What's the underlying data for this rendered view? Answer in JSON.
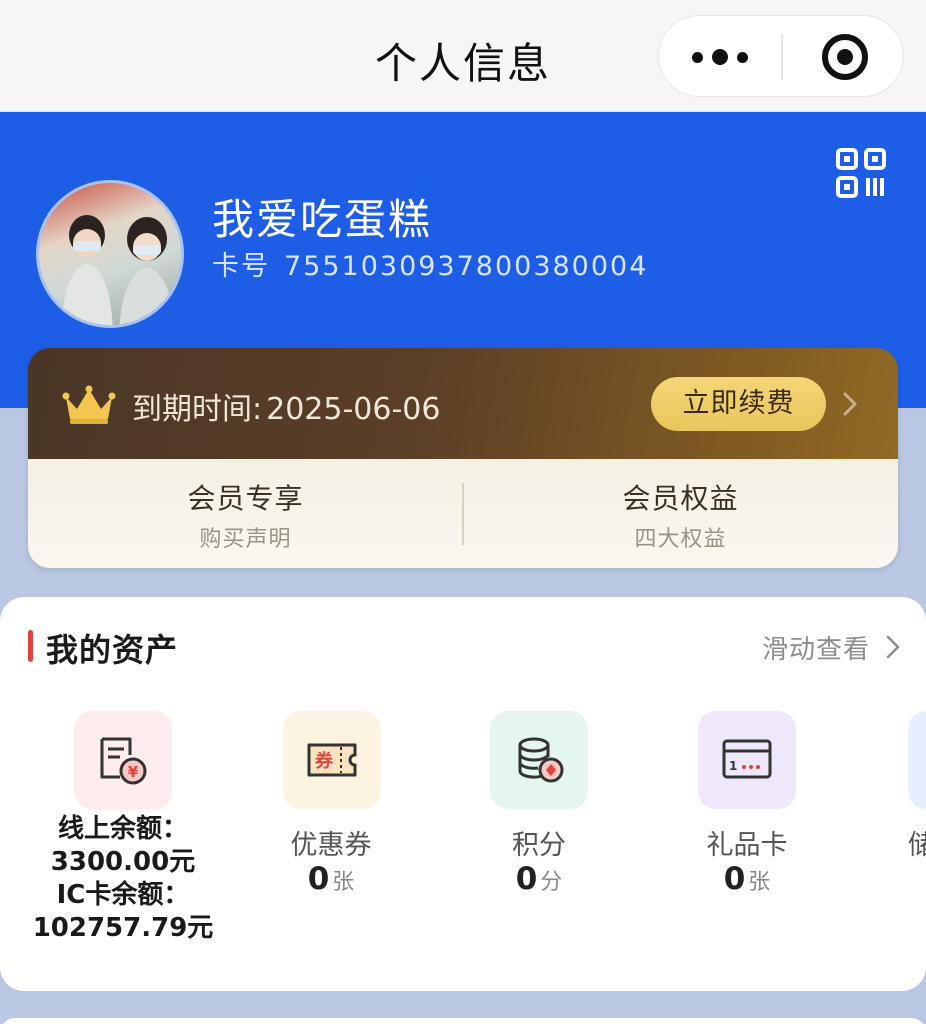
{
  "navbar": {
    "title": "个人信息",
    "more_icon": "more-dots-icon",
    "close_icon": "target-circle-icon"
  },
  "profile": {
    "username": "我爱吃蛋糕",
    "card_label": "卡号",
    "card_number": "7551030937800380004",
    "qr_icon": "qr-code-icon",
    "accent_color": "#1e5ee6"
  },
  "membership": {
    "expiry_label": "到期时间:",
    "expiry_date": "2025-06-06",
    "renew_label": "立即续费",
    "perks": [
      {
        "title": "会员专享",
        "subtitle": "购买声明"
      },
      {
        "title": "会员权益",
        "subtitle": "四大权益"
      }
    ]
  },
  "assets": {
    "title": "我的资产",
    "slide_hint": "滑动查看",
    "balance": {
      "line1": "线上余额：",
      "line2": "3300.00元",
      "line3": "IC卡余额：",
      "line4": "102757.79元"
    },
    "items": [
      {
        "label": "优惠券",
        "value": "0",
        "unit": "张",
        "icon": "coupon-icon"
      },
      {
        "label": "积分",
        "value": "0",
        "unit": "分",
        "icon": "points-coins-icon"
      },
      {
        "label": "礼品卡",
        "value": "0",
        "unit": "张",
        "icon": "gift-card-icon"
      },
      {
        "label": "储",
        "value": "",
        "unit": "",
        "icon": "partial-tile-icon"
      }
    ]
  }
}
